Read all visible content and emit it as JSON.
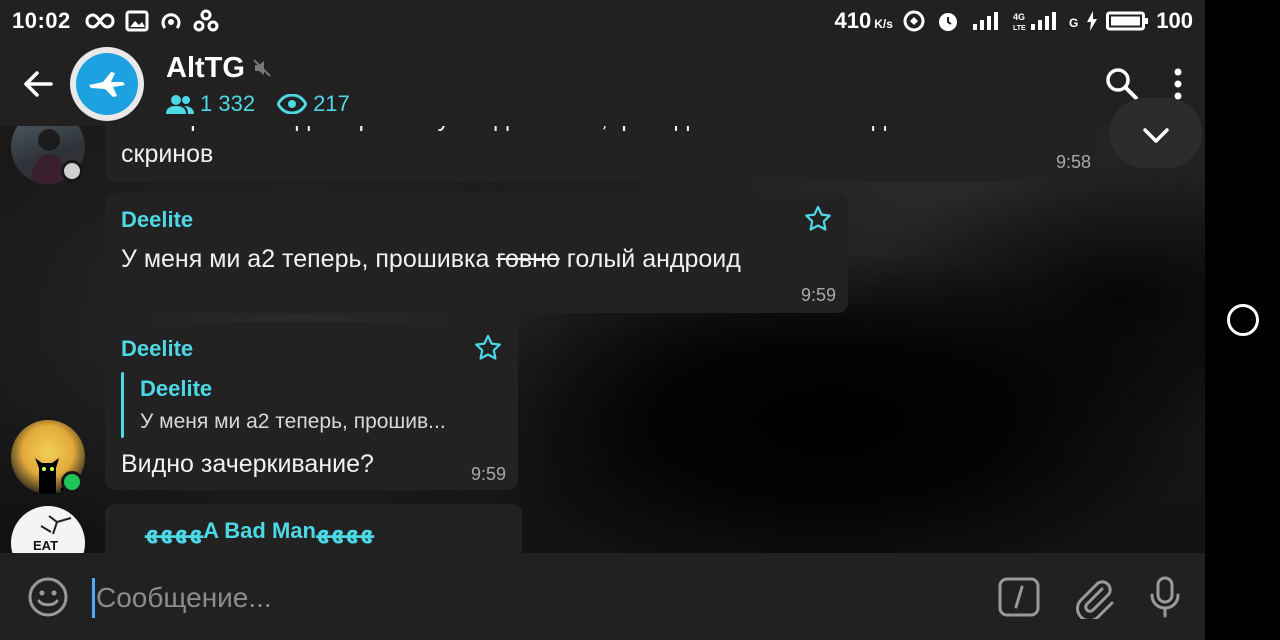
{
  "status_bar": {
    "time": "10:02",
    "speed_value": "410",
    "speed_unit": "K/s",
    "network_g": "G",
    "battery": "100"
  },
  "header": {
    "channel_title": "AltTG",
    "members": "1 332",
    "views": "217"
  },
  "messages": [
    {
      "text_line1": "А то просто когда переписку скидываешь,приходится несколько делать",
      "text_line2": "скринов",
      "time": "9:58"
    },
    {
      "sender": "Deelite",
      "text_before": "У меня ми а2 теперь, прошивка ",
      "text_strike": "говно",
      "text_after": " голый андроид",
      "time": "9:59"
    },
    {
      "sender": "Deelite",
      "reply_sender": "Deelite",
      "reply_text": "У меня ми а2 теперь, прошив...",
      "text": "Видно зачеркивание?",
      "time": "9:59"
    },
    {
      "sender": "ﻬﻬﻬﻬA Bad Manﻬﻬﻬﻬ"
    }
  ],
  "input": {
    "placeholder": "Сообщение..."
  },
  "colors": {
    "accent": "#4dd8e6",
    "bubble": "#222222",
    "bar": "#212121",
    "online": "#21c45a"
  }
}
